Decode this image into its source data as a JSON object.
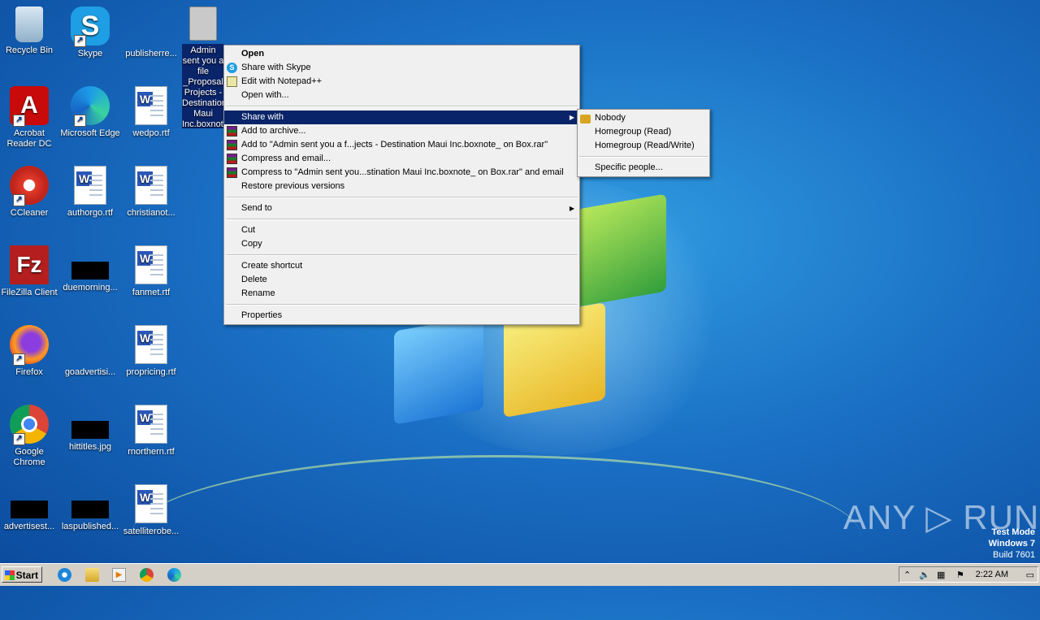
{
  "desktop_icons": [
    {
      "label": "Recycle Bin"
    },
    {
      "label": "Skype"
    },
    {
      "label": "publisherre..."
    },
    {
      "label": "Admin sent you a file _Proposal Projects - Destination Maui Inc.boxnote_ on Box.e..."
    },
    {
      "label": "Acrobat Reader DC"
    },
    {
      "label": "Microsoft Edge"
    },
    {
      "label": "wedpo.rtf"
    },
    {
      "label": "CCleaner"
    },
    {
      "label": "authorgo.rtf"
    },
    {
      "label": "christianot..."
    },
    {
      "label": "FileZilla Client"
    },
    {
      "label": "duemorning..."
    },
    {
      "label": "fanmet.rtf"
    },
    {
      "label": "Firefox"
    },
    {
      "label": "goadvertisi..."
    },
    {
      "label": "propricing.rtf"
    },
    {
      "label": "Google Chrome"
    },
    {
      "label": "hittitles.jpg"
    },
    {
      "label": "rnorthern.rtf"
    },
    {
      "label": "advertisest..."
    },
    {
      "label": "laspublished..."
    },
    {
      "label": "satelliterobe..."
    }
  ],
  "context_menu": {
    "items": [
      {
        "label": "Open"
      },
      {
        "label": "Share with Skype"
      },
      {
        "label": "Edit with Notepad++"
      },
      {
        "label": "Open with..."
      },
      {
        "label": "Share with"
      },
      {
        "label": "Add to archive..."
      },
      {
        "label": "Add to \"Admin sent you a f...jects - Destination Maui Inc.boxnote_ on  Box.rar\""
      },
      {
        "label": "Compress and email..."
      },
      {
        "label": "Compress to \"Admin sent you...stination Maui Inc.boxnote_ on  Box.rar\" and email"
      },
      {
        "label": "Restore previous versions"
      },
      {
        "label": "Send to"
      },
      {
        "label": "Cut"
      },
      {
        "label": "Copy"
      },
      {
        "label": "Create shortcut"
      },
      {
        "label": "Delete"
      },
      {
        "label": "Rename"
      },
      {
        "label": "Properties"
      }
    ]
  },
  "share_submenu": {
    "items": [
      {
        "label": "Nobody"
      },
      {
        "label": "Homegroup (Read)"
      },
      {
        "label": "Homegroup (Read/Write)"
      },
      {
        "label": "Specific people..."
      }
    ]
  },
  "taskbar": {
    "start_label": "Start",
    "clock": "2:22 AM"
  },
  "watermark": {
    "text": "ANY ▷ RUN",
    "test_mode": "Test Mode",
    "os": "Windows 7",
    "build": "Build 7601"
  }
}
